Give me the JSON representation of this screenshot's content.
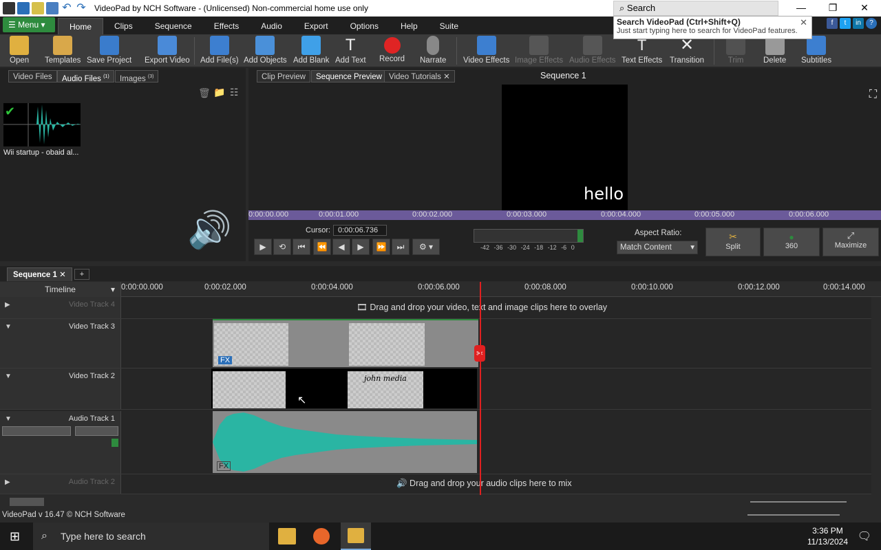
{
  "window": {
    "title": "VideoPad by NCH Software - (Unlicensed) Non-commercial home use only",
    "search_placeholder": "Search",
    "search_popup_title": "Search VideoPad (Ctrl+Shift+Q)",
    "search_popup_hint": "Just start typing here to search for VideoPad features."
  },
  "menu": {
    "button": "Menu",
    "tabs": [
      "Home",
      "Clips",
      "Sequence",
      "Effects",
      "Audio",
      "Export",
      "Options",
      "Help",
      "Suite"
    ]
  },
  "toolbar": {
    "open": "Open",
    "templates": "Templates",
    "save_project": "Save Project",
    "export_video": "Export Video",
    "add_files": "Add File(s)",
    "add_objects": "Add Objects",
    "add_blank": "Add Blank",
    "add_text": "Add Text",
    "record": "Record",
    "narrate": "Narrate",
    "video_effects": "Video Effects",
    "image_effects": "Image Effects",
    "audio_effects": "Audio Effects",
    "text_effects": "Text Effects",
    "transition": "Transition",
    "trim": "Trim",
    "delete": "Delete",
    "subtitles": "Subtitles"
  },
  "files_panel": {
    "tabs": [
      "Video Files",
      "Audio Files",
      "Images"
    ],
    "audio_count": "(1)",
    "image_count": "(3)",
    "item_label": "Wii startup - obaid al..."
  },
  "preview": {
    "tabs": [
      "Clip Preview",
      "Sequence Preview",
      "Video Tutorials"
    ],
    "title": "Sequence 1",
    "frame_text": "hello",
    "ruler_labels": [
      "0:00:00.000",
      "0:00:01.000",
      "0:00:02.000",
      "0:00:03.000",
      "0:00:04.000",
      "0:00:05.000",
      "0:00:06.000"
    ],
    "cursor_label": "Cursor:",
    "cursor_value": "0:00:06.736",
    "level_labels": [
      "-42",
      "-36",
      "-30",
      "-24",
      "-18",
      "-12",
      "-6",
      "0"
    ],
    "aspect_label": "Aspect Ratio:",
    "aspect_value": "Match Content",
    "split": "Split",
    "three60": "360",
    "maximize": "Maximize"
  },
  "timeline": {
    "sequence_tab": "Sequence 1",
    "add_tab": "+",
    "timeline_label": "Timeline",
    "ruler_labels": [
      "0:00:00.000",
      "0:00:02.000",
      "0:00:04.000",
      "0:00:06.000",
      "0:00:08.000",
      "0:00:10.000",
      "0:00:12.000",
      "0:00:14.000"
    ],
    "tracks": {
      "v4": "Video Track 4",
      "v3": "Video Track 3",
      "v2": "Video Track 2",
      "a1": "Audio Track 1",
      "a2": "Audio Track 2"
    },
    "overlay_hint": "Drag and drop your video, text and image clips here to overlay",
    "mix_hint": "Drag and drop your audio clips here to mix",
    "clip_text": "john media",
    "fx": "FX"
  },
  "status": {
    "version": "VideoPad v 16.47 © NCH Software"
  },
  "taskbar": {
    "search_placeholder": "Type here to search",
    "time": "3:36 PM",
    "date": "11/13/2024"
  },
  "colors": {
    "accent_green": "#2e8b3e",
    "playhead": "#e02020",
    "wave": "#2ab5a3",
    "ruler_purple": "#6b5a9a"
  }
}
